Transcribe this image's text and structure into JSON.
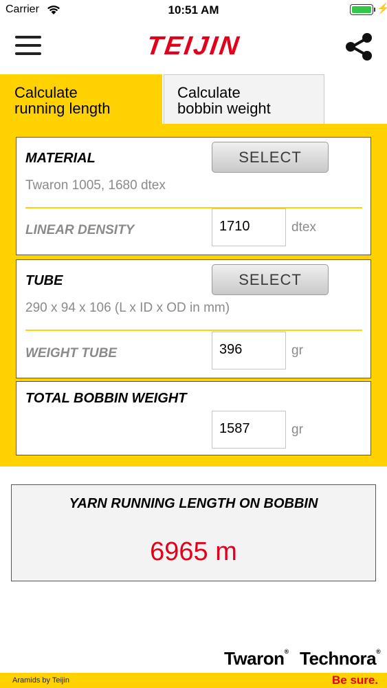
{
  "status_bar": {
    "carrier": "Carrier",
    "time": "10:51 AM",
    "battery_level": 1.0
  },
  "header": {
    "logo_text": "TEIJIN"
  },
  "tabs": [
    {
      "label_line1": "Calculate",
      "label_line2": "running length",
      "active": true
    },
    {
      "label_line1": "Calculate",
      "label_line2": "bobbin weight",
      "active": false
    }
  ],
  "material": {
    "title": "MATERIAL",
    "select_label": "SELECT",
    "selected": "Twaron 1005, 1680 dtex",
    "field_label": "LINEAR DENSITY",
    "value": "1710",
    "unit": "dtex"
  },
  "tube": {
    "title": "TUBE",
    "select_label": "SELECT",
    "selected": "290 x 94 x 106 (L x ID x OD in mm)",
    "field_label": "WEIGHT TUBE",
    "value": "396",
    "unit": "gr"
  },
  "total": {
    "title": "TOTAL BOBBIN WEIGHT",
    "value": "1587",
    "unit": "gr"
  },
  "result": {
    "title": "YARN RUNNING LENGTH ON BOBBIN",
    "value": "6965 m"
  },
  "footer": {
    "brand1": "Twaron",
    "brand2": "Technora",
    "reg_mark": "®",
    "left_text": "Aramids by Teijin",
    "right_text": "Be sure."
  },
  "colors": {
    "accent_yellow": "#ffd200",
    "brand_red": "#e3001b"
  }
}
